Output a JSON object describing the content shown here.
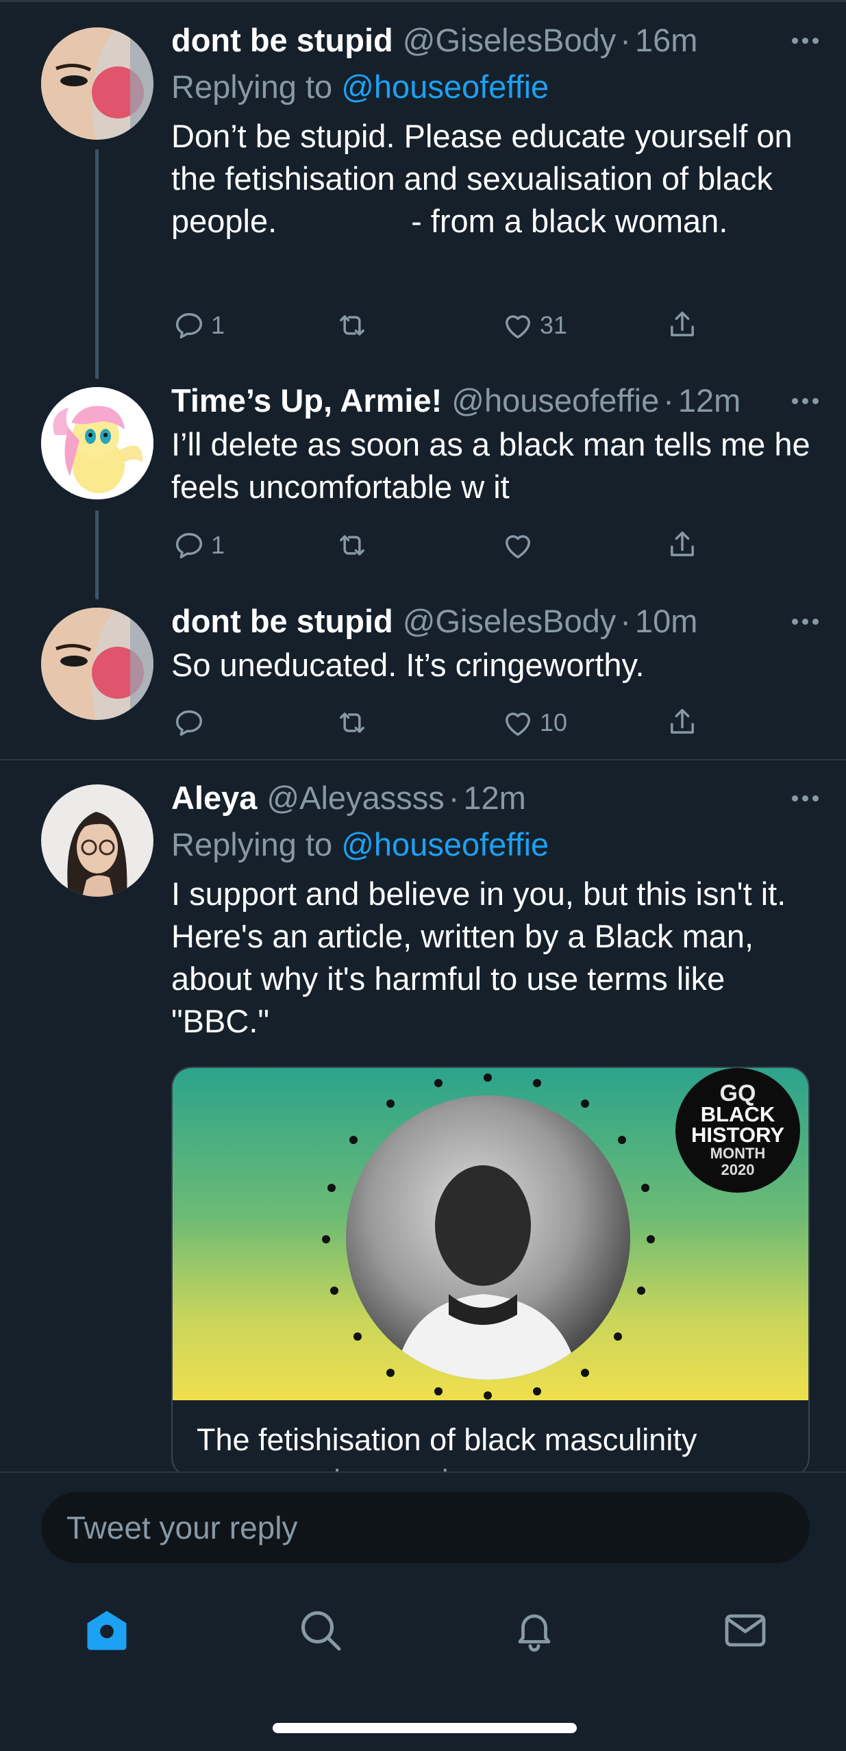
{
  "colors": {
    "background": "#15202b",
    "secondary_text": "#8899a6",
    "link": "#1da1f2",
    "thread_line": "#3d5466"
  },
  "tweets": [
    {
      "name": "dont be stupid",
      "handle": "@GiselesBody",
      "separator": "·",
      "time": "16m",
      "replying_prefix": "Replying to",
      "replying_to": "@houseofeffie",
      "text": "Don’t be stupid. Please educate yourself on the fetishisation and sexualisation of black people.               - from a black woman.",
      "reply_count": "1",
      "retweet_count": "",
      "like_count": "31"
    },
    {
      "name": "Time’s Up, Armie!",
      "handle": "@houseofeffie",
      "separator": "·",
      "time": "12m",
      "text": "I’ll delete as soon as a black man tells me he feels uncomfortable w it",
      "reply_count": "1",
      "retweet_count": "",
      "like_count": ""
    },
    {
      "name": "dont be stupid",
      "handle": "@GiselesBody",
      "separator": "·",
      "time": "10m",
      "text": "So uneducated. It’s cringeworthy.",
      "reply_count": "",
      "retweet_count": "",
      "like_count": "10"
    },
    {
      "name": "Aleya",
      "handle": "@Aleyassss",
      "separator": "·",
      "time": "12m",
      "replying_prefix": "Replying to",
      "replying_to": "@houseofeffie",
      "text": "I support and believe in you, but this isn't it. Here's an article, written by a Black man, about why it's harmful to use terms like \"BBC.\"",
      "card": {
        "badge_gq": "GQ",
        "badge_line1": "BLACK",
        "badge_line2": "HISTORY",
        "badge_line3": "MONTH",
        "badge_line4": "2020",
        "title": "The fetishisation of black masculinity",
        "domain": "gq-magazine.co.uk"
      }
    }
  ],
  "reply_box": {
    "placeholder": "Tweet your reply"
  },
  "tabs": [
    {
      "name": "home-icon",
      "active": true
    },
    {
      "name": "search-icon",
      "active": false
    },
    {
      "name": "bell-icon",
      "active": false
    },
    {
      "name": "mail-icon",
      "active": false
    }
  ]
}
